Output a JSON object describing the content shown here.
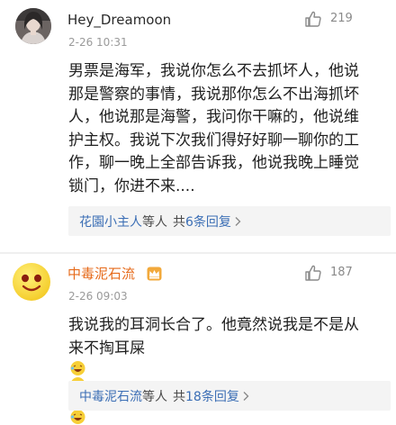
{
  "comments": [
    {
      "username": "Hey_Dreamoon",
      "time": "2-26 10:31",
      "likes": "219",
      "avatar_icon": "portrait-photo",
      "text_lines": [
        "男票是海军，我说你怎么不去抓坏人，他说",
        "那是警察的事情，我说那你怎么不出海抓坏",
        "人，他说那是海警，我问你干嘛的，他说维",
        "护主权。我说下次我们得好好聊一聊你的工",
        "作，聊一晚上全部告诉我，他说我晚上睡觉",
        "锁门，你进不来...."
      ],
      "reply": {
        "name": "花園小主人",
        "suffix": "等人",
        "gong": "共",
        "count": "6条回复"
      }
    },
    {
      "username": "中毒泥石流",
      "time": "2-26 09:03",
      "likes": "187",
      "avatar_icon": "smiling-emoji",
      "text_lines": [
        "我说我的耳洞长合了。他竟然说我是不是从",
        "来不掏耳屎"
      ],
      "text_emoji_count": 4,
      "reply": {
        "name": "中毒泥石流",
        "suffix": "等人",
        "gong": "共",
        "count": "18条回复"
      }
    }
  ],
  "colors": {
    "username_orange": "#e66a1a",
    "link_blue": "#3b6eb5",
    "meta_gray": "#9a9a9a",
    "reply_bg": "#f4f4f4"
  }
}
